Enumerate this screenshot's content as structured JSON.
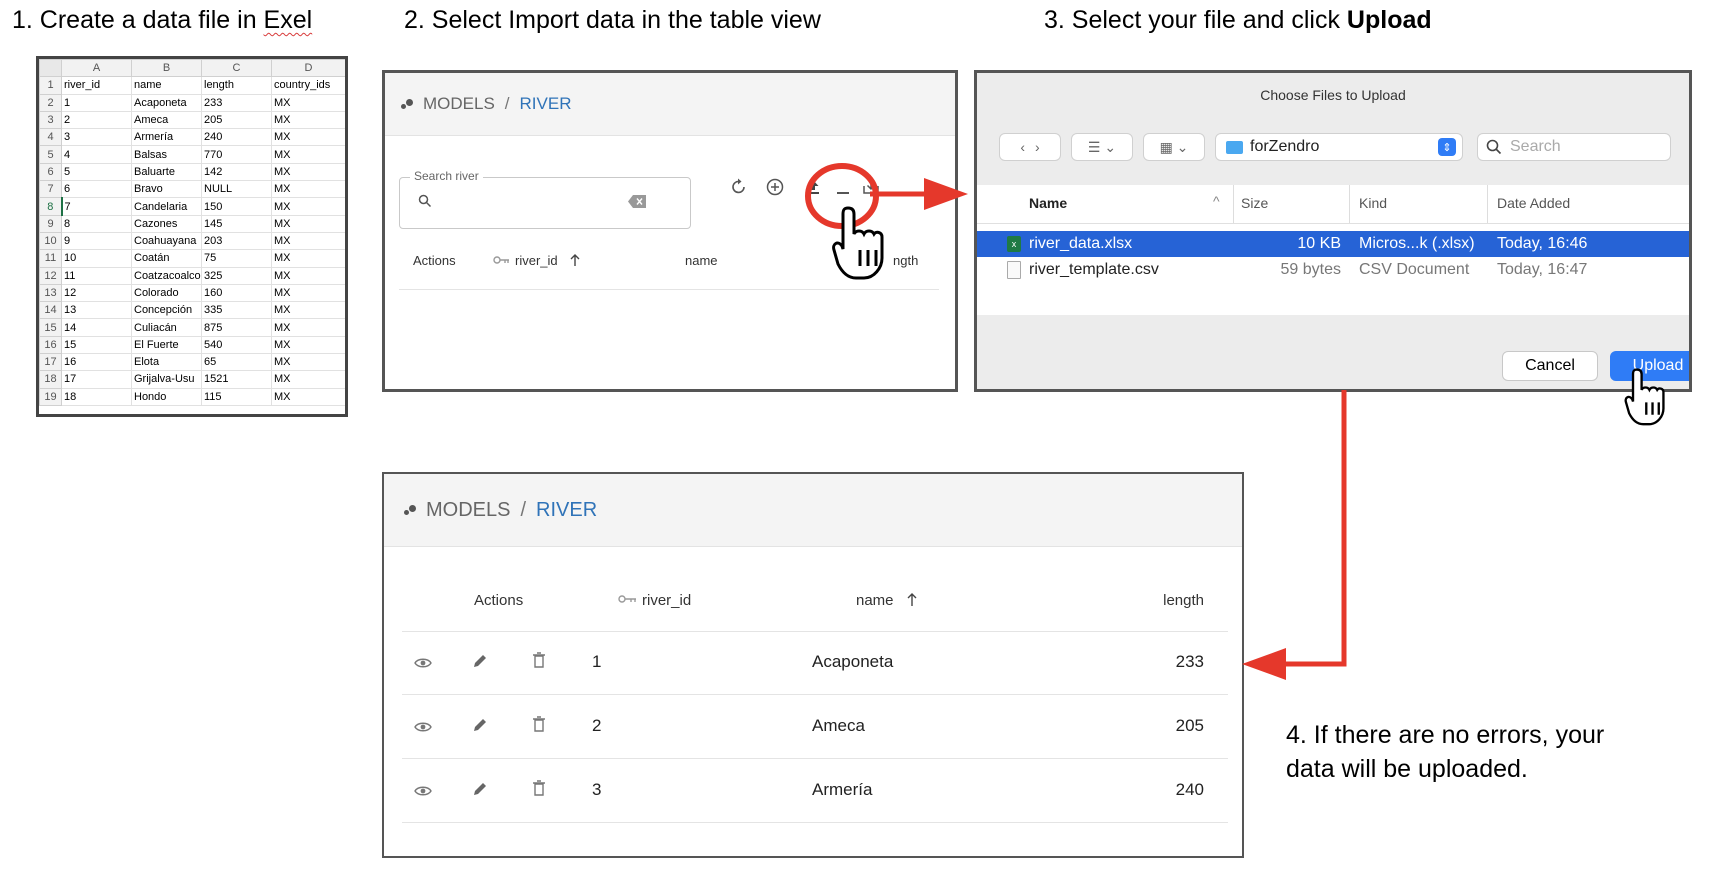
{
  "steps": {
    "step1": "1. Create a data file in ",
    "step1_word": "Exel",
    "step2": "2. Select Import data in the table view",
    "step3_prefix": "3. Select your file and click ",
    "step3_bold": "Upload",
    "step4_line1": "4. If there are no errors, your",
    "step4_line2": "data will be uploaded."
  },
  "excel": {
    "columns": [
      "A",
      "B",
      "C",
      "D"
    ],
    "rows": [
      [
        "river_id",
        "name",
        "length",
        "country_ids"
      ],
      [
        "1",
        "Acaponeta",
        "233",
        "MX"
      ],
      [
        "2",
        "Ameca",
        "205",
        "MX"
      ],
      [
        "3",
        "Armería",
        "240",
        "MX"
      ],
      [
        "4",
        "Balsas",
        "770",
        "MX"
      ],
      [
        "5",
        "Baluarte",
        "142",
        "MX"
      ],
      [
        "6",
        "Bravo",
        "NULL",
        "MX"
      ],
      [
        "7",
        "Candelaria",
        "150",
        "MX"
      ],
      [
        "8",
        "Cazones",
        "145",
        "MX"
      ],
      [
        "9",
        "Coahuayana",
        "203",
        "MX"
      ],
      [
        "10",
        "Coatán",
        "75",
        "MX"
      ],
      [
        "11",
        "Coatzacoalco",
        "325",
        "MX"
      ],
      [
        "12",
        "Colorado",
        "160",
        "MX"
      ],
      [
        "13",
        "Concepción",
        "335",
        "MX"
      ],
      [
        "14",
        "Culiacán",
        "875",
        "MX"
      ],
      [
        "15",
        "El Fuerte",
        "540",
        "MX"
      ],
      [
        "16",
        "Elota",
        "65",
        "MX"
      ],
      [
        "17",
        "Grijalva-Usu",
        "1521",
        "MX"
      ],
      [
        "18",
        "Hondo",
        "115",
        "MX"
      ]
    ]
  },
  "app": {
    "breadcrumb_root": "MODELS",
    "breadcrumb_sep": "/",
    "breadcrumb_current": "RIVER",
    "search_label": "Search river",
    "col_actions": "Actions",
    "col_river_id": "river_id",
    "col_name": "name",
    "col_length_partial": "ngth",
    "col_length": "length"
  },
  "dialog": {
    "title": "Choose Files to Upload",
    "folder": "forZendro",
    "search_placeholder": "Search",
    "headers": {
      "name": "Name",
      "size": "Size",
      "kind": "Kind",
      "date_added": "Date Added"
    },
    "files": [
      {
        "name": "river_data.xlsx",
        "size": "10 KB",
        "kind": "Micros...k (.xlsx)",
        "date": "Today, 16:46",
        "selected": true
      },
      {
        "name": "river_template.csv",
        "size": "59 bytes",
        "kind": "CSV Document",
        "date": "Today, 16:47",
        "selected": false
      }
    ],
    "cancel": "Cancel",
    "upload": "Upload"
  },
  "result_rows": [
    {
      "river_id": "1",
      "name": "Acaponeta",
      "length": "233"
    },
    {
      "river_id": "2",
      "name": "Ameca",
      "length": "205"
    },
    {
      "river_id": "3",
      "name": "Armería",
      "length": "240"
    }
  ],
  "colors": {
    "arrow": "#e5382b",
    "link": "#2f73b8",
    "selection": "#2663d6",
    "upload_button": "#2f7cf6"
  }
}
